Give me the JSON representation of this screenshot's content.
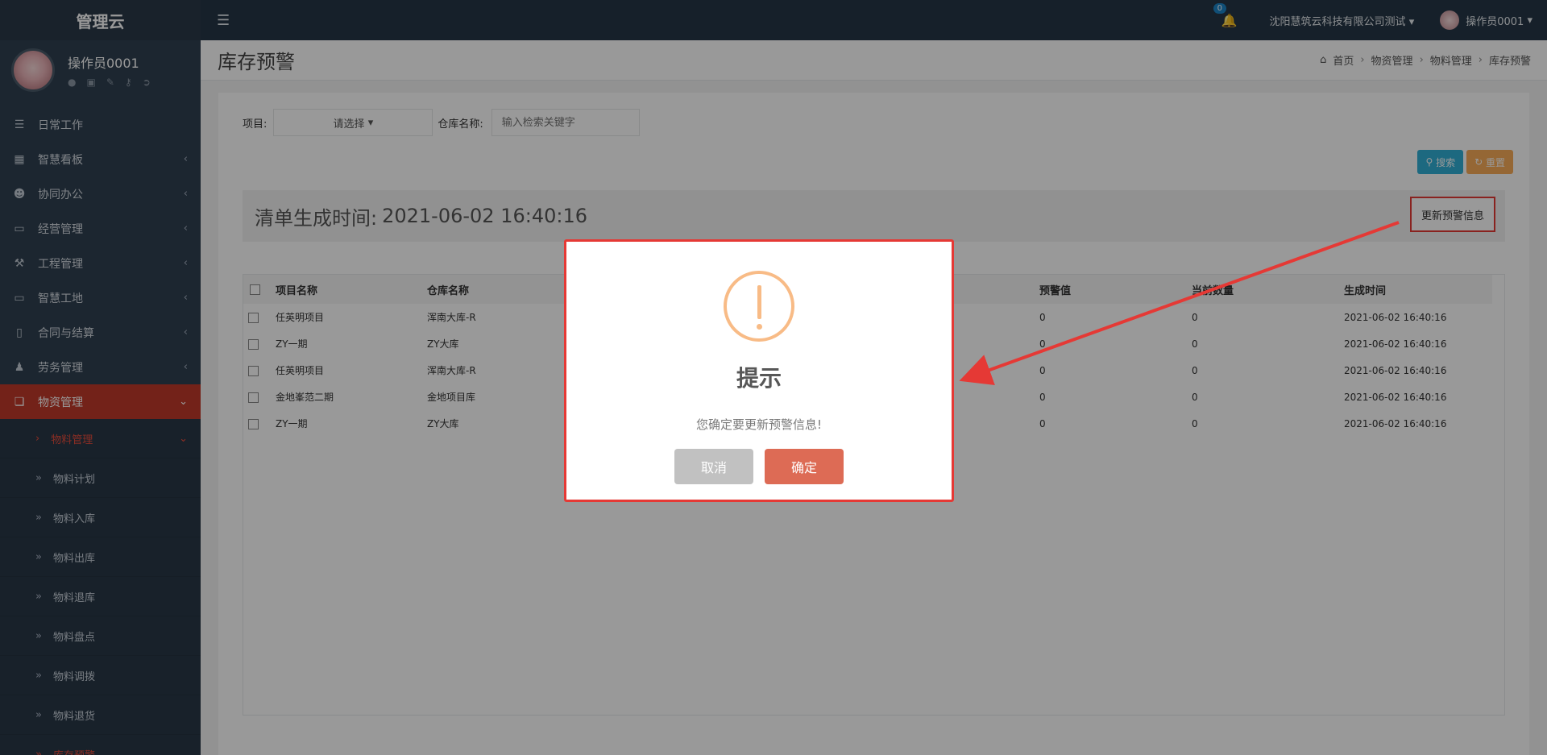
{
  "app": {
    "brand": "管理云"
  },
  "profile": {
    "name": "操作员0001",
    "icons": [
      "user-icon",
      "card-icon",
      "edit-icon",
      "key-icon",
      "logout-icon"
    ]
  },
  "sidebar": {
    "items": [
      {
        "label": "日常工作",
        "icon": "list-icon"
      },
      {
        "label": "智慧看板",
        "icon": "dashboard-icon"
      },
      {
        "label": "协同办公",
        "icon": "users-icon"
      },
      {
        "label": "经营管理",
        "icon": "monitor-icon"
      },
      {
        "label": "工程管理",
        "icon": "hammer-icon"
      },
      {
        "label": "智慧工地",
        "icon": "monitor-icon"
      },
      {
        "label": "合同与结算",
        "icon": "file-icon"
      },
      {
        "label": "劳务管理",
        "icon": "worker-icon"
      },
      {
        "label": "物资管理",
        "icon": "cube-icon"
      }
    ],
    "sub_items": [
      {
        "label": "物料管理"
      },
      {
        "label": "物料计划"
      },
      {
        "label": "物料入库"
      },
      {
        "label": "物料出库"
      },
      {
        "label": "物料退库"
      },
      {
        "label": "物料盘点"
      },
      {
        "label": "物料调拨"
      },
      {
        "label": "物料退货"
      },
      {
        "label": "库存预警"
      }
    ]
  },
  "topbar": {
    "notification_count": "0",
    "company": "沈阳慧筑云科技有限公司测试",
    "user": "操作员0001"
  },
  "page": {
    "title": "库存预警",
    "breadcrumb": [
      "首页",
      "物资管理",
      "物料管理",
      "库存预警"
    ]
  },
  "filters": {
    "project_label": "项目:",
    "project_select": "请选择",
    "warehouse_label": "仓库名称:",
    "warehouse_placeholder": "输入检索关键字",
    "search_btn": "搜索",
    "reset_btn": "重置"
  },
  "gen": {
    "label": "清单生成时间:",
    "time": "2021-06-02 16:40:16",
    "update_btn": "更新预警信息"
  },
  "table": {
    "headers": [
      "项目名称",
      "仓库名称",
      "预警值",
      "当前数量",
      "生成时间"
    ],
    "rows": [
      [
        "任英明项目",
        "浑南大库-R",
        "0",
        "0",
        "2021-06-02 16:40:16"
      ],
      [
        "ZY一期",
        "ZY大库",
        "0",
        "0",
        "2021-06-02 16:40:16"
      ],
      [
        "任英明项目",
        "浑南大库-R",
        "0",
        "0",
        "2021-06-02 16:40:16"
      ],
      [
        "金地峯范二期",
        "金地项目库",
        "0",
        "0",
        "2021-06-02 16:40:16"
      ],
      [
        "ZY一期",
        "ZY大库",
        "0",
        "0",
        "2021-06-02 16:40:16"
      ]
    ]
  },
  "dialog": {
    "title": "提示",
    "message": "您确定要更新预警信息!",
    "cancel": "取消",
    "ok": "确定"
  },
  "colors": {
    "accent": "#c0392b",
    "sidebar": "#2f4050",
    "highlight": "#e53935",
    "ok": "#dd6b55"
  }
}
